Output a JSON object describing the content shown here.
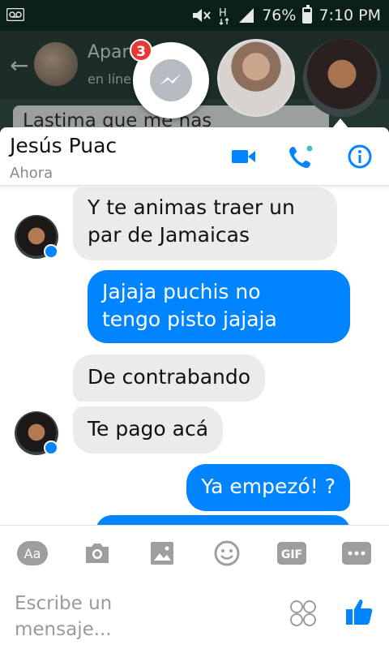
{
  "status_bar": {
    "battery": "76%",
    "battery_level": 0.76,
    "time": "7:10 PM"
  },
  "background_app": {
    "contact_name": "Apar",
    "contact_status": "en líne",
    "last_message": "Lastima que me has"
  },
  "chat_heads": {
    "badge_count": "3"
  },
  "conversation": {
    "name": "Jesús Puac",
    "status": "Ahora",
    "messages": [
      {
        "side": "in",
        "text_line1": "Y te animas traer un",
        "text_line2": "par de Jamaicas"
      },
      {
        "side": "out",
        "text_line1": "Jajaja puchis no",
        "text_line2": "tengo pisto jajaja"
      },
      {
        "side": "in",
        "text": "De contrabando"
      },
      {
        "side": "in",
        "text": "Te pago acá"
      },
      {
        "side": "out",
        "text": "Ya empezó! ?"
      }
    ]
  },
  "composer": {
    "aa_label": "Aa",
    "gif_label": "GIF",
    "placeholder_line1": "Escribe un",
    "placeholder_line2": "mensaje..."
  },
  "colors": {
    "accent": "#0084ff",
    "incoming_bubble": "#ebebeb",
    "icon_gray": "#9e9e9e",
    "online_green": "#44bec7"
  }
}
